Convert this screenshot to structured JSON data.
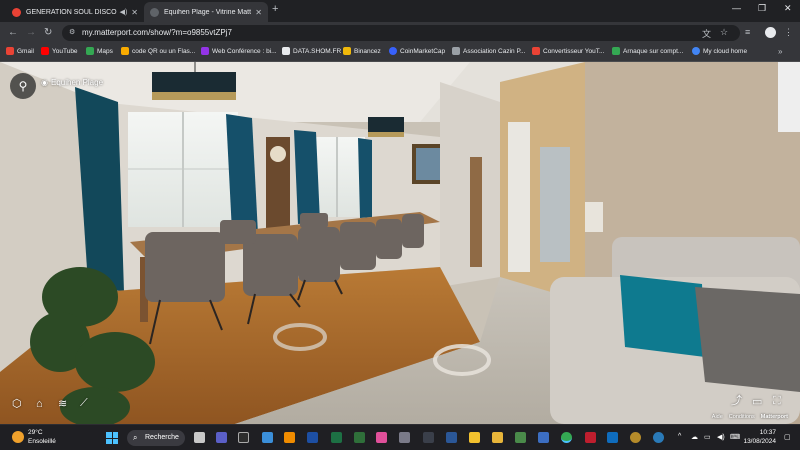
{
  "browser": {
    "tabs": [
      {
        "label": "GÉNÉRATION SOUL DISCO",
        "favicon_color": "#e94235"
      },
      {
        "label": "Equihen Plage - Vitrine Matterp",
        "favicon_color": "#5f6368"
      }
    ],
    "url": "my.matterport.com/show/?m=o9855vtZPj7",
    "bookmarks": [
      {
        "label": "Gmail",
        "color": "#ea4335"
      },
      {
        "label": "YouTube",
        "color": "#ff0000"
      },
      {
        "label": "Maps",
        "color": "#34a853"
      },
      {
        "label": "code QR ou un Flas...",
        "color": "#f9ab00"
      },
      {
        "label": "Web Conférence : bi...",
        "color": "#9334e6"
      },
      {
        "label": "DATA.SHOM.FR",
        "color": "#e8eaed"
      },
      {
        "label": "Binancez",
        "color": "#f0b90b"
      },
      {
        "label": "CoinMarketCap",
        "color": "#3861fb"
      },
      {
        "label": "Association Cazin P...",
        "color": "#9aa0a6"
      },
      {
        "label": "Convertisseur YouT...",
        "color": "#ea4335"
      },
      {
        "label": "Arnaque sur compt...",
        "color": "#34a853"
      },
      {
        "label": "My cloud home",
        "color": "#4285f4"
      }
    ]
  },
  "viewer": {
    "space_name": "Equihen Plage",
    "footer_links": [
      "Aide",
      "Conditions",
      "Matterport"
    ]
  },
  "taskbar": {
    "weather_temp": "29°C",
    "weather_desc": "Ensoleillé",
    "search_label": "Recherche",
    "time": "10:37",
    "date": "13/08/2024"
  },
  "icons": {
    "search": "search-icon",
    "pin": "location-pin-icon",
    "share": "share-icon",
    "vr": "vr-icon",
    "fullscreen": "fullscreen-icon"
  }
}
